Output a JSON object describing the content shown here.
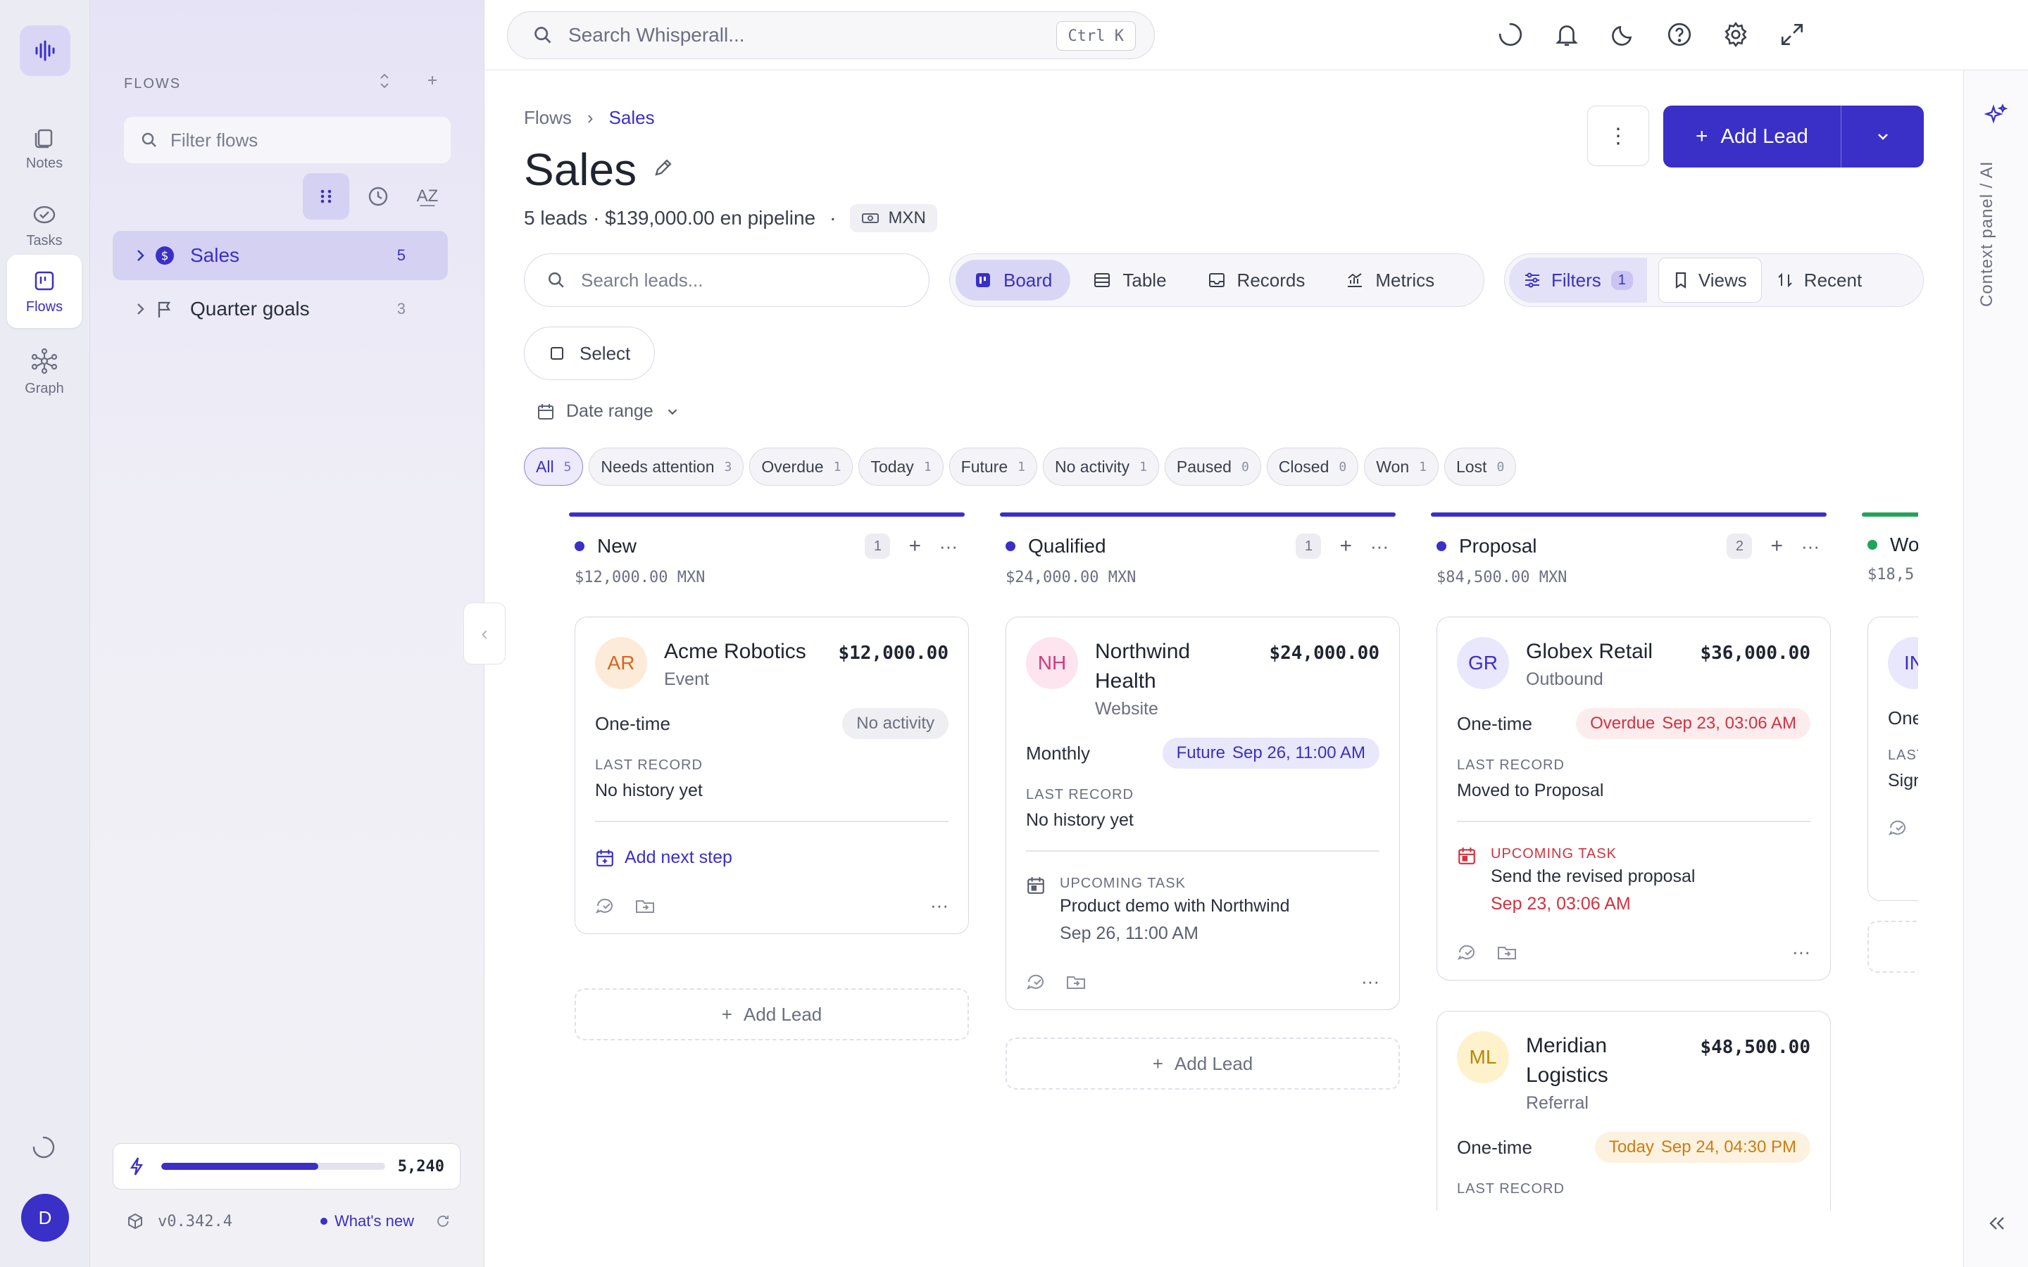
{
  "rail": {
    "items": [
      {
        "label": "Notes",
        "icon": "notes-icon"
      },
      {
        "label": "Tasks",
        "icon": "tasks-icon"
      },
      {
        "label": "Flows",
        "icon": "flows-icon"
      },
      {
        "label": "Graph",
        "icon": "graph-icon"
      }
    ],
    "user_initial": "D"
  },
  "sidebar": {
    "title": "FLOWS",
    "filter_placeholder": "Filter flows",
    "flows": [
      {
        "name": "Sales",
        "count": "5"
      },
      {
        "name": "Quarter goals",
        "count": "3"
      }
    ],
    "credits": {
      "value": "5,240",
      "fill_fraction": 0.7
    },
    "version": "v0.342.4",
    "whats_new": "What's new"
  },
  "topbar": {
    "search_placeholder": "Search Whisperall...",
    "shortcut": "Ctrl K"
  },
  "context_panel_label": "Context panel / AI",
  "main": {
    "breadcrumb": [
      "Flows",
      "Sales"
    ],
    "title": "Sales",
    "summary": "5 leads · $139,000.00 en pipeline",
    "separator": "·",
    "currency": "MXN",
    "more_label": "⋮",
    "add_lead_label": "Add Lead",
    "lead_search_placeholder": "Search leads...",
    "view_tabs": [
      "Board",
      "Table",
      "Records",
      "Metrics"
    ],
    "filters_label": "Filters",
    "filters_count": "1",
    "views_label": "Views",
    "recent_label": "Recent",
    "select_label": "Select",
    "date_range_label": "Date range",
    "chips": [
      {
        "label": "All",
        "count": "5"
      },
      {
        "label": "Needs attention",
        "count": "3"
      },
      {
        "label": "Overdue",
        "count": "1"
      },
      {
        "label": "Today",
        "count": "1"
      },
      {
        "label": "Future",
        "count": "1"
      },
      {
        "label": "No activity",
        "count": "1"
      },
      {
        "label": "Paused",
        "count": "0"
      },
      {
        "label": "Closed",
        "count": "0"
      },
      {
        "label": "Won",
        "count": "1"
      },
      {
        "label": "Lost",
        "count": "0"
      }
    ]
  },
  "board": {
    "add_lead_label": "Add Lead",
    "last_record_label": "LAST RECORD",
    "upcoming_task_label": "UPCOMING TASK",
    "add_next_step": "Add next step",
    "columns": [
      {
        "name": "New",
        "count": "1",
        "total": "$12,000.00 MXN"
      },
      {
        "name": "Qualified",
        "count": "1",
        "total": "$24,000.00 MXN"
      },
      {
        "name": "Proposal",
        "count": "2",
        "total": "$84,500.00 MXN"
      },
      {
        "name": "Wo",
        "total": "$18,5"
      }
    ],
    "cards": [
      {
        "initials": "AR",
        "name": "Acme Robotics",
        "source": "Event",
        "amount": "$12,000.00",
        "billing": "One-time",
        "status": "No activity",
        "last_record": "No history yet"
      },
      {
        "initials": "NH",
        "name": "Northwind Health",
        "source": "Website",
        "amount": "$24,000.00",
        "billing": "Monthly",
        "status_tag": "Future",
        "status_date": "Sep 26, 11:00 AM",
        "last_record": "No history yet",
        "task_title": "Product demo with Northwind",
        "task_date": "Sep 26, 11:00 AM"
      },
      {
        "initials": "GR",
        "name": "Globex Retail",
        "source": "Outbound",
        "amount": "$36,000.00",
        "billing": "One-time",
        "status_tag": "Overdue",
        "status_date": "Sep 23, 03:06 AM",
        "last_record": "Moved to Proposal",
        "task_title": "Send the revised proposal",
        "task_date": "Sep 23, 03:06 AM"
      },
      {
        "initials": "ML",
        "name": "Meridian Logistics",
        "source": "Referral",
        "amount": "$48,500.00",
        "billing": "One-time",
        "status_tag": "Today",
        "status_date": "Sep 24, 04:30 PM"
      },
      {
        "initials": "IN",
        "billing": "One",
        "last_record_partial": "LAST",
        "last_record": "Sign"
      }
    ]
  },
  "colors": {
    "accent": "#3a2fc7",
    "won": "#22a35a",
    "overdue": "#d2323e",
    "today": "#d07b10"
  }
}
